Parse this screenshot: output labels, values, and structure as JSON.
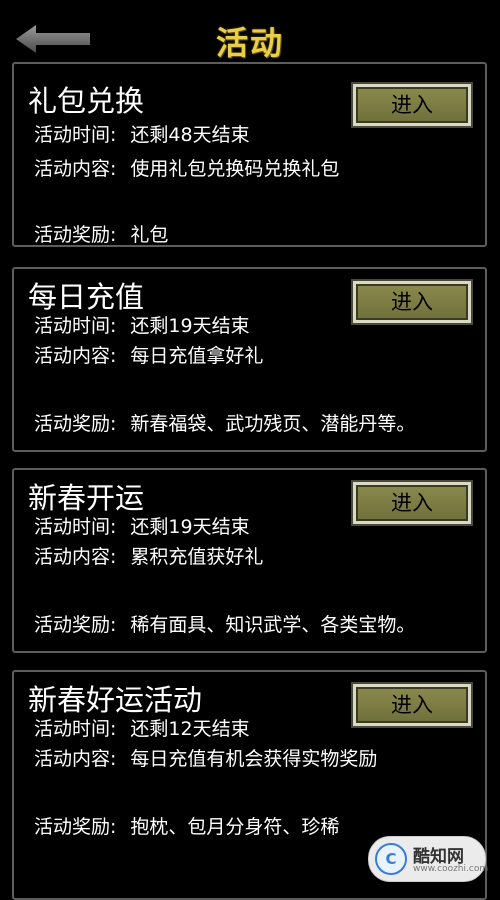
{
  "header": {
    "title": "活动",
    "back_icon": "back-arrow-icon"
  },
  "cards": [
    {
      "title": "礼包兑换",
      "button": "进入",
      "time_label": "活动时间:",
      "time_value": "还剩48天结束",
      "content_label": "活动内容:",
      "content_value": "使用礼包兑换码兑换礼包",
      "reward_label": "活动奖励:",
      "reward_value": "礼包"
    },
    {
      "title": "每日充值",
      "button": "进入",
      "time_label": "活动时间:",
      "time_value": "还剩19天结束",
      "content_label": "活动内容:",
      "content_value": "每日充值拿好礼",
      "reward_label": "活动奖励:",
      "reward_value": "新春福袋、武功残页、潜能丹等。"
    },
    {
      "title": "新春开运",
      "button": "进入",
      "time_label": "活动时间:",
      "time_value": "还剩19天结束",
      "content_label": "活动内容:",
      "content_value": "累积充值获好礼",
      "reward_label": "活动奖励:",
      "reward_value": "稀有面具、知识武学、各类宝物。"
    },
    {
      "title": "新春好运活动",
      "button": "进入",
      "time_label": "活动时间:",
      "time_value": "还剩12天结束",
      "content_label": "活动内容:",
      "content_value": "每日充值有机会获得实物奖励",
      "reward_label": "活动奖励:",
      "reward_value": "抱枕、包月分身符、珍稀"
    }
  ],
  "watermark": {
    "text": "酷知网",
    "sub": "www.coozhi.com",
    "logo": "C"
  },
  "colors": {
    "title": "#e8cf4a",
    "button_bg": "#7d7d45",
    "card_border": "#5d5d5d"
  }
}
